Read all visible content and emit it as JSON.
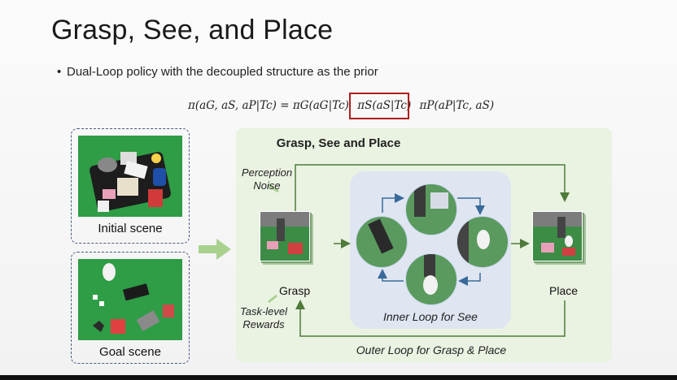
{
  "slide": {
    "title": "Grasp, See, and Place",
    "bullet": "Dual-Loop policy with the decoupled structure as the prior",
    "formula_prefix": "π(aG, aS, aP|Tc) = πG(aG|Tc)",
    "formula_highlight": "πS(aS|Tc)",
    "formula_suffix": "πP(aP|Tc, aS)"
  },
  "scenes": {
    "initial_label": "Initial scene",
    "goal_label": "Goal scene"
  },
  "diagram": {
    "title": "Grasp, See and Place",
    "perception_noise": "Perception Noise",
    "task_rewards": "Task-level Rewards",
    "grasp_label": "Grasp",
    "place_label": "Place",
    "inner_loop": "Inner Loop for See",
    "outer_loop": "Outer Loop for Grasp & Place"
  },
  "colors": {
    "panel_bg": "#eaf2e2",
    "inner_bg": "#dfe6f2",
    "highlight_box": "#b11d1d",
    "outer_arrow": "#4f7a3a",
    "inner_arrow": "#3a6a9a",
    "big_arrow": "#a9d18e"
  }
}
